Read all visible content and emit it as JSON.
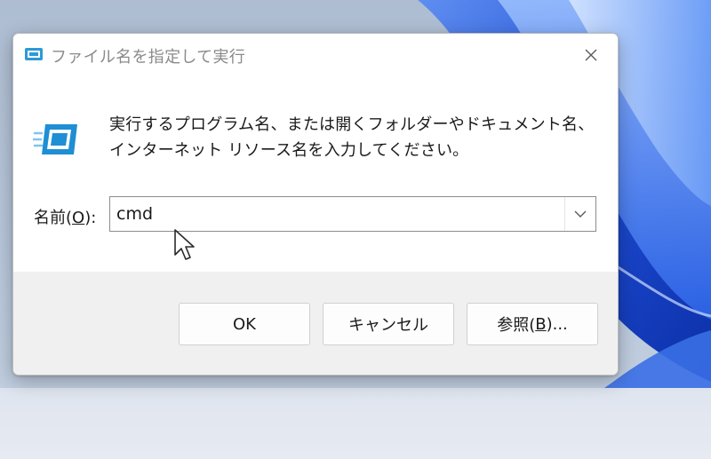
{
  "dialog": {
    "title": "ファイル名を指定して実行",
    "description": "実行するプログラム名、または開くフォルダーやドキュメント名、インターネット リソース名を入力してください。",
    "name_label_prefix": "名前(",
    "name_label_mnemonic": "O",
    "name_label_suffix": "):",
    "input_value": "cmd",
    "buttons": {
      "ok": "OK",
      "cancel": "キャンセル",
      "browse_prefix": "参照(",
      "browse_mnemonic": "B",
      "browse_suffix": ")..."
    }
  },
  "icons": {
    "title": "run-icon",
    "close": "close-icon",
    "dropdown": "chevron-down-icon",
    "cursor": "mouse-pointer-icon"
  },
  "colors": {
    "accent": "#0f6cbd",
    "wallpaper_blue": "#1f4fd6",
    "dialog_bg": "#f0f0f0"
  }
}
